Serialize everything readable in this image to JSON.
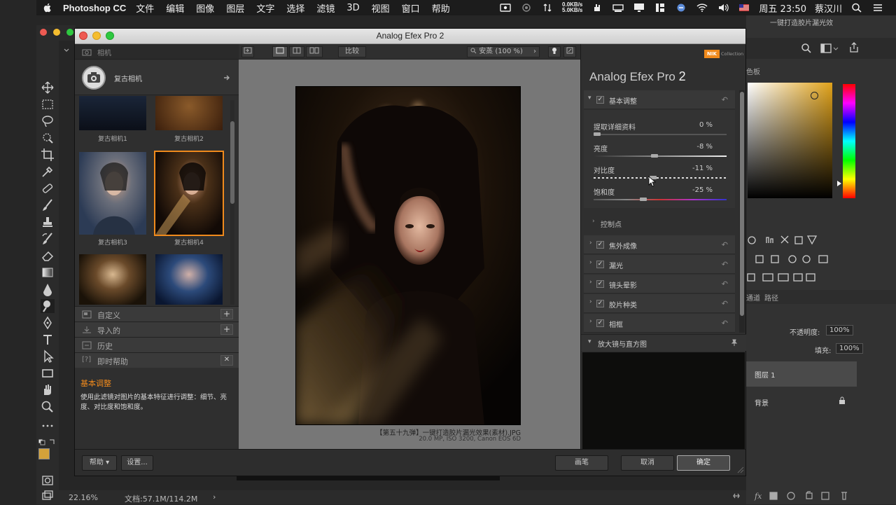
{
  "menubar": {
    "app_name": "Photoshop CC",
    "items": [
      "文件",
      "编辑",
      "图像",
      "图层",
      "文字",
      "选择",
      "滤镜",
      "3D",
      "视图",
      "窗口",
      "帮助"
    ],
    "net_up": "0.0KB/s",
    "net_down": "5.0KB/s",
    "clock": "周五 23:50",
    "user": "蔡汉川"
  },
  "window": {
    "title": "Analog Efex Pro 2"
  },
  "left_panel": {
    "header_label": "相机",
    "camera_title": "复古相机",
    "thumbs": [
      {
        "label": "复古相机1"
      },
      {
        "label": "复古相机2"
      },
      {
        "label": "复古相机3"
      },
      {
        "label": "复古相机4"
      }
    ],
    "sections": {
      "custom": "自定义",
      "imported": "导入的",
      "history": "历史",
      "help": "即时帮助",
      "help_icon": "[?]"
    },
    "help_title": "基本调整",
    "help_body": "使用此滤镜对图片的基本特征进行调整：细节、亮度、对比度和饱和度。"
  },
  "center": {
    "compare_label": "比较",
    "zoom_label": "安蒸 (100 %)",
    "filename": "【第五十九弹】一键打造胶片漏光效果(素材).JPG",
    "meta": "20.0 MP, ISO 3200, Canon EOS 6D"
  },
  "right_panel": {
    "brand_badge": "NIK",
    "brand_sub": "Collection",
    "title_main": "Analog Efex Pro",
    "title_num": "2",
    "basic_title": "基本调整",
    "sliders": [
      {
        "label": "提取详细资料",
        "value": "0 %",
        "level": 0
      },
      {
        "label": "亮度",
        "value": "-8 %",
        "level": -8
      },
      {
        "label": "对比度",
        "value": "-11 %",
        "level": -11
      },
      {
        "label": "饱和度",
        "value": "-25 %",
        "level": -25
      }
    ],
    "control_points": "控制点",
    "filters": [
      "焦外成像",
      "漏光",
      "镜头晕影",
      "胶片种类",
      "相框"
    ],
    "loupe_title": "放大镜与直方图"
  },
  "bottom": {
    "help_btn": "帮助",
    "settings_btn": "设置...",
    "brush_btn": "画笔",
    "cancel_btn": "取消",
    "ok_btn": "确定"
  },
  "ps": {
    "zoom": "22.16%",
    "doc": "文档:57.1M/114.2M",
    "top_right_text": "一键打造胶片漏光效",
    "panel_label_1": "色板",
    "channels_tab": "通道",
    "paths_tab": "路径",
    "opacity_label": "不透明度:",
    "opacity_value": "100%",
    "fill_label": "填充:",
    "fill_value": "100%",
    "layer1": "图层 1",
    "background": "背景"
  },
  "colors": {
    "accent_orange": "#f08a1c",
    "ok_button": "#4a4a4a",
    "fg_swatch": "#d4a23a"
  }
}
